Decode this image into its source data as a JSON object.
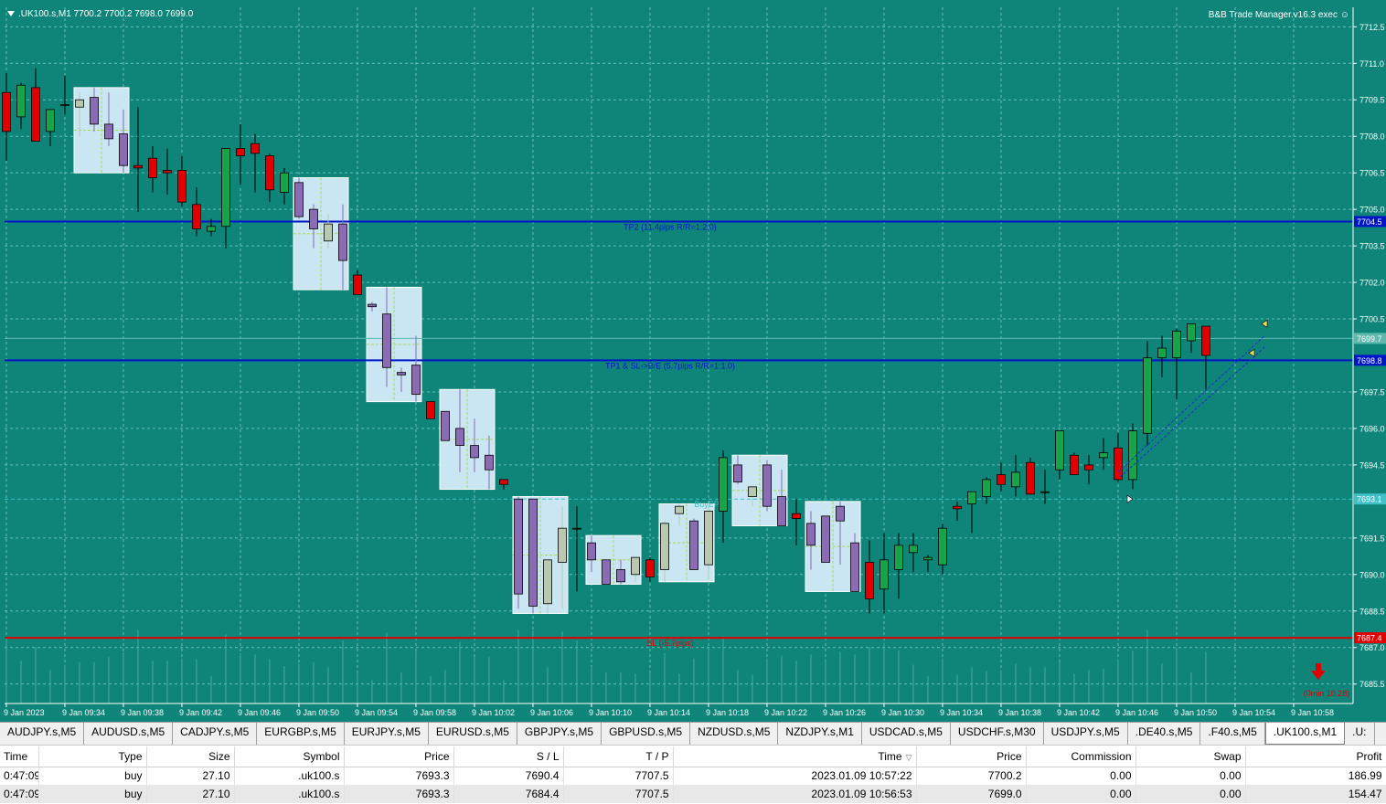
{
  "chart": {
    "symbol_label": ".UK100.s,M1  7700.2 7700.2 7698.0 7699.0",
    "ea_label": "B&B Trade Manager.v16.3 exec",
    "ea_icon": "smiley-icon",
    "background_color": "#0f857a",
    "bull_color": "#16a34a",
    "bear_color": "#e00000",
    "tp_line_color": "#0014c8",
    "sl_line_color": "#e00000",
    "box_color": "#c9e6f2",
    "price_ticks": [
      "7712.5",
      "7711.0",
      "7709.5",
      "7708.0",
      "7706.5",
      "7705.0",
      "7703.5",
      "7702.0",
      "7700.5",
      "7697.5",
      "7696.0",
      "7694.5",
      "7691.5",
      "7690.0",
      "7688.5",
      "7687.0",
      "7685.5"
    ],
    "time_ticks": [
      "9 Jan 2023",
      "9 Jan 09:34",
      "9 Jan 09:38",
      "9 Jan 09:42",
      "9 Jan 09:46",
      "9 Jan 09:50",
      "9 Jan 09:54",
      "9 Jan 09:58",
      "9 Jan 10:02",
      "9 Jan 10:06",
      "9 Jan 10:10",
      "9 Jan 10:14",
      "9 Jan 10:18",
      "9 Jan 10:22",
      "9 Jan 10:26",
      "9 Jan 10:30",
      "9 Jan 10:34",
      "9 Jan 10:38",
      "9 Jan 10:42",
      "9 Jan 10:46",
      "9 Jan 10:50",
      "9 Jan 10:54",
      "9 Jan 10:58"
    ],
    "lines": {
      "tp2": {
        "price": 7704.5,
        "label": "TP2 (11.4pips R/R=1:2.0)",
        "badge": "7704.5"
      },
      "tp1": {
        "price": 7698.8,
        "label": "TP1 & SL->B/E (5.7pips R/R=1:1.0)",
        "badge": "7698.8"
      },
      "sl": {
        "price": 7687.4,
        "label": "SL (-5.7pips)",
        "badge": "7687.4"
      },
      "bid": {
        "price": 7699.7,
        "badge": "7699.7"
      },
      "buy_ep": {
        "price": 7693.1,
        "label": "BuyEP",
        "badge": "7693.1"
      }
    },
    "timer_label": "(0min 10.28)"
  },
  "chart_data": {
    "type": "candlestick",
    "title": ".UK100.s,M1",
    "ylim": [
      7684.7,
      7713.3
    ],
    "candles": [
      {
        "o": 7709.8,
        "h": 7710.6,
        "l": 7707.0,
        "c": 7708.2
      },
      {
        "o": 7708.8,
        "h": 7710.2,
        "l": 7708.3,
        "c": 7710.1
      },
      {
        "o": 7710.0,
        "h": 7710.8,
        "l": 7707.8,
        "c": 7707.8
      },
      {
        "o": 7708.2,
        "h": 7708.8,
        "l": 7707.6,
        "c": 7709.1
      },
      {
        "o": 7709.3,
        "h": 7710.5,
        "l": 7708.9,
        "c": 7709.3
      },
      {
        "o": 7709.2,
        "h": 7709.8,
        "l": 7708.0,
        "c": 7709.5
      },
      {
        "o": 7709.6,
        "h": 7710.0,
        "l": 7708.2,
        "c": 7708.5
      },
      {
        "o": 7708.5,
        "h": 7709.8,
        "l": 7707.6,
        "c": 7707.9
      },
      {
        "o": 7708.1,
        "h": 7709.1,
        "l": 7706.5,
        "c": 7706.8
      },
      {
        "o": 7706.8,
        "h": 7709.2,
        "l": 7704.9,
        "c": 7706.7
      },
      {
        "o": 7707.1,
        "h": 7707.6,
        "l": 7705.7,
        "c": 7706.3
      },
      {
        "o": 7706.6,
        "h": 7707.5,
        "l": 7705.6,
        "c": 7706.5
      },
      {
        "o": 7706.6,
        "h": 7707.2,
        "l": 7705.1,
        "c": 7705.3
      },
      {
        "o": 7705.2,
        "h": 7705.9,
        "l": 7703.9,
        "c": 7704.2
      },
      {
        "o": 7704.1,
        "h": 7704.6,
        "l": 7703.9,
        "c": 7704.3
      },
      {
        "o": 7704.3,
        "h": 7707.4,
        "l": 7703.4,
        "c": 7707.5
      },
      {
        "o": 7707.5,
        "h": 7708.5,
        "l": 7706.0,
        "c": 7707.2
      },
      {
        "o": 7707.7,
        "h": 7708.1,
        "l": 7705.7,
        "c": 7707.3
      },
      {
        "o": 7707.2,
        "h": 7707.3,
        "l": 7705.3,
        "c": 7705.8
      },
      {
        "o": 7705.7,
        "h": 7706.7,
        "l": 7705.2,
        "c": 7706.5
      },
      {
        "o": 7706.1,
        "h": 7706.3,
        "l": 7704.6,
        "c": 7704.7
      },
      {
        "o": 7705.0,
        "h": 7705.2,
        "l": 7703.4,
        "c": 7704.2
      },
      {
        "o": 7703.7,
        "h": 7704.8,
        "l": 7703.4,
        "c": 7704.4
      },
      {
        "o": 7704.4,
        "h": 7705.2,
        "l": 7701.7,
        "c": 7702.9
      },
      {
        "o": 7702.3,
        "h": 7702.5,
        "l": 7701.5,
        "c": 7701.5
      },
      {
        "o": 7701.1,
        "h": 7701.2,
        "l": 7700.8,
        "c": 7701.0
      },
      {
        "o": 7700.7,
        "h": 7701.8,
        "l": 7697.7,
        "c": 7698.5
      },
      {
        "o": 7698.3,
        "h": 7698.5,
        "l": 7697.5,
        "c": 7698.2
      },
      {
        "o": 7698.6,
        "h": 7699.8,
        "l": 7697.1,
        "c": 7697.4
      },
      {
        "o": 7697.1,
        "h": 7697.1,
        "l": 7696.4,
        "c": 7696.4
      },
      {
        "o": 7696.7,
        "h": 7696.7,
        "l": 7695.5,
        "c": 7695.5
      },
      {
        "o": 7696.0,
        "h": 7697.6,
        "l": 7694.2,
        "c": 7695.3
      },
      {
        "o": 7695.3,
        "h": 7696.4,
        "l": 7694.2,
        "c": 7694.8
      },
      {
        "o": 7694.9,
        "h": 7695.7,
        "l": 7693.5,
        "c": 7694.3
      },
      {
        "o": 7693.9,
        "h": 7693.9,
        "l": 7693.5,
        "c": 7693.7
      },
      {
        "o": 7693.1,
        "h": 7693.2,
        "l": 7688.6,
        "c": 7689.2
      },
      {
        "o": 7693.1,
        "h": 7693.1,
        "l": 7688.4,
        "c": 7688.7
      },
      {
        "o": 7688.8,
        "h": 7689.8,
        "l": 7688.4,
        "c": 7690.6
      },
      {
        "o": 7690.5,
        "h": 7692.8,
        "l": 7688.6,
        "c": 7691.9
      },
      {
        "o": 7691.9,
        "h": 7692.8,
        "l": 7689.3,
        "c": 7691.9
      },
      {
        "o": 7691.3,
        "h": 7691.6,
        "l": 7690.1,
        "c": 7690.6
      },
      {
        "o": 7690.6,
        "h": 7690.6,
        "l": 7689.6,
        "c": 7689.6
      },
      {
        "o": 7690.2,
        "h": 7690.6,
        "l": 7689.6,
        "c": 7689.7
      },
      {
        "o": 7690.0,
        "h": 7690.6,
        "l": 7689.7,
        "c": 7690.7
      },
      {
        "o": 7690.6,
        "h": 7690.7,
        "l": 7689.7,
        "c": 7689.9
      },
      {
        "o": 7690.2,
        "h": 7692.2,
        "l": 7689.7,
        "c": 7692.1
      },
      {
        "o": 7692.5,
        "h": 7692.9,
        "l": 7692.0,
        "c": 7692.8
      },
      {
        "o": 7692.2,
        "h": 7692.3,
        "l": 7690.2,
        "c": 7690.2
      },
      {
        "o": 7690.4,
        "h": 7692.8,
        "l": 7689.8,
        "c": 7692.6
      },
      {
        "o": 7692.6,
        "h": 7695.1,
        "l": 7691.3,
        "c": 7694.8
      },
      {
        "o": 7694.5,
        "h": 7694.9,
        "l": 7693.7,
        "c": 7693.8
      },
      {
        "o": 7693.2,
        "h": 7693.6,
        "l": 7692.8,
        "c": 7693.6
      },
      {
        "o": 7694.5,
        "h": 7694.7,
        "l": 7692.6,
        "c": 7692.8
      },
      {
        "o": 7693.2,
        "h": 7694.3,
        "l": 7692.0,
        "c": 7692.0
      },
      {
        "o": 7692.5,
        "h": 7693.1,
        "l": 7691.2,
        "c": 7692.3
      },
      {
        "o": 7692.1,
        "h": 7692.6,
        "l": 7690.2,
        "c": 7691.2
      },
      {
        "o": 7692.4,
        "h": 7692.4,
        "l": 7690.5,
        "c": 7690.5
      },
      {
        "o": 7692.8,
        "h": 7693.0,
        "l": 7690.4,
        "c": 7692.2
      },
      {
        "o": 7691.3,
        "h": 7691.7,
        "l": 7689.3,
        "c": 7689.3
      },
      {
        "o": 7690.5,
        "h": 7691.4,
        "l": 7688.4,
        "c": 7689.0
      },
      {
        "o": 7689.4,
        "h": 7691.7,
        "l": 7688.4,
        "c": 7690.6
      },
      {
        "o": 7690.2,
        "h": 7691.7,
        "l": 7689.0,
        "c": 7691.2
      },
      {
        "o": 7690.9,
        "h": 7691.7,
        "l": 7690.1,
        "c": 7691.2
      },
      {
        "o": 7690.6,
        "h": 7690.8,
        "l": 7690.1,
        "c": 7690.7
      },
      {
        "o": 7690.4,
        "h": 7692.1,
        "l": 7690.0,
        "c": 7691.9
      },
      {
        "o": 7692.8,
        "h": 7693.0,
        "l": 7692.2,
        "c": 7692.7
      },
      {
        "o": 7692.9,
        "h": 7693.1,
        "l": 7691.7,
        "c": 7693.4
      },
      {
        "o": 7693.2,
        "h": 7694.0,
        "l": 7692.9,
        "c": 7693.9
      },
      {
        "o": 7694.1,
        "h": 7694.6,
        "l": 7693.4,
        "c": 7693.7
      },
      {
        "o": 7693.6,
        "h": 7694.9,
        "l": 7693.2,
        "c": 7694.2
      },
      {
        "o": 7694.6,
        "h": 7694.8,
        "l": 7693.4,
        "c": 7693.3
      },
      {
        "o": 7693.4,
        "h": 7694.3,
        "l": 7692.9,
        "c": 7693.4
      },
      {
        "o": 7694.3,
        "h": 7695.7,
        "l": 7693.9,
        "c": 7695.9
      },
      {
        "o": 7694.9,
        "h": 7695.0,
        "l": 7694.1,
        "c": 7694.1
      },
      {
        "o": 7694.5,
        "h": 7694.9,
        "l": 7693.7,
        "c": 7694.3
      },
      {
        "o": 7694.8,
        "h": 7695.6,
        "l": 7694.3,
        "c": 7695.0
      },
      {
        "o": 7695.2,
        "h": 7695.8,
        "l": 7693.8,
        "c": 7693.9
      },
      {
        "o": 7693.9,
        "h": 7696.2,
        "l": 7693.5,
        "c": 7695.9
      },
      {
        "o": 7695.8,
        "h": 7699.6,
        "l": 7695.3,
        "c": 7698.9
      },
      {
        "o": 7698.9,
        "h": 7699.8,
        "l": 7698.1,
        "c": 7699.3
      },
      {
        "o": 7698.9,
        "h": 7700.1,
        "l": 7697.2,
        "c": 7700.0
      },
      {
        "o": 7699.6,
        "h": 7700.1,
        "l": 7699.1,
        "c": 7700.3
      },
      {
        "o": 7700.2,
        "h": 7700.2,
        "l": 7697.6,
        "c": 7699.0
      }
    ]
  },
  "tabs": {
    "items": [
      {
        "label": "AUDJPY.s,M5"
      },
      {
        "label": "AUDUSD.s,M5"
      },
      {
        "label": "CADJPY.s,M5"
      },
      {
        "label": "EURGBP.s,M5"
      },
      {
        "label": "EURJPY.s,M5"
      },
      {
        "label": "EURUSD.s,M5"
      },
      {
        "label": "GBPJPY.s,M5"
      },
      {
        "label": "GBPUSD.s,M5"
      },
      {
        "label": "NZDUSD.s,M5"
      },
      {
        "label": "NZDJPY.s,M1"
      },
      {
        "label": "USDCAD.s,M5"
      },
      {
        "label": "USDCHF.s,M30"
      },
      {
        "label": "USDJPY.s,M5"
      },
      {
        "label": ".DE40.s,M5"
      },
      {
        "label": ".F40.s,M5"
      },
      {
        "label": ".UK100.s,M1"
      },
      {
        "label": ".U:"
      }
    ],
    "active_index": 15
  },
  "trades": {
    "headers": {
      "time": "Time",
      "type": "Type",
      "size": "Size",
      "symbol": "Symbol",
      "price": "Price",
      "sl": "S / L",
      "tp": "T / P",
      "close_time": "Time",
      "close_price": "Price",
      "commission": "Commission",
      "swap": "Swap",
      "profit": "Profit"
    },
    "sort_indicator": "▽",
    "rows": [
      {
        "time": "0:47:09",
        "type": "buy",
        "size": "27.10",
        "symbol": ".uk100.s",
        "price": "7693.3",
        "sl": "7690.4",
        "tp": "7707.5",
        "close_time": "2023.01.09 10:57:22",
        "close_price": "7700.2",
        "commission": "0.00",
        "swap": "0.00",
        "profit": "186.99"
      },
      {
        "time": "0:47:09",
        "type": "buy",
        "size": "27.10",
        "symbol": ".uk100.s",
        "price": "7693.3",
        "sl": "7684.4",
        "tp": "7707.5",
        "close_time": "2023.01.09 10:56:53",
        "close_price": "7699.0",
        "commission": "0.00",
        "swap": "0.00",
        "profit": "154.47"
      }
    ]
  }
}
